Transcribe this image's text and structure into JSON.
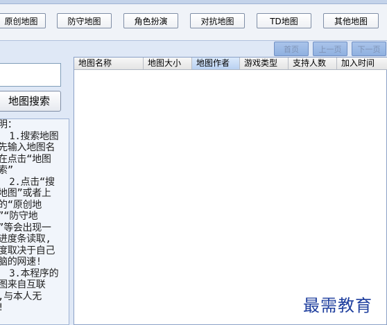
{
  "categories": [
    "原创地图",
    "防守地图",
    "角色扮演",
    "对抗地图",
    "TD地图",
    "其他地图"
  ],
  "pager": {
    "first": "首页",
    "prev": "上一页",
    "next": "下一页"
  },
  "search": {
    "value": "",
    "placeholder": "",
    "button_label": "地图搜索"
  },
  "help": {
    "lines": [
      "明：",
      "  1.搜索地图",
      "先输入地图名",
      "在点击“地图",
      "索”",
      "  2.点击“搜",
      "地图”或者上",
      "的“原创地",
      "”“防守地",
      "”等会出现一",
      "进度条读取,",
      "度取决于自己",
      "脑的网速!",
      "  3.本程序的",
      "图来自互联",
      ",与本人无",
      "!"
    ]
  },
  "table": {
    "columns": [
      "地图名称",
      "地图大小",
      "地图作者",
      "游戏类型",
      "支持人数",
      "加入时间"
    ],
    "active_column": 2,
    "rows": []
  },
  "watermark": "最需教育"
}
